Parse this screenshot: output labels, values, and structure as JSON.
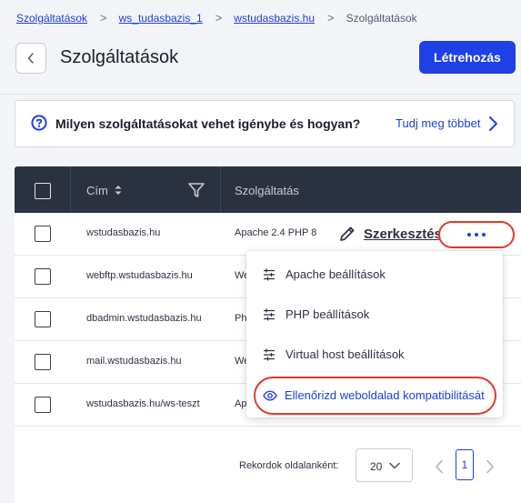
{
  "breadcrumb": {
    "items": [
      "Szolgáltatások",
      "ws_tudasbazis_1",
      "wstudasbazis.hu"
    ],
    "current": "Szolgáltatások",
    "separator": ">"
  },
  "header": {
    "title": "Szolgáltatások",
    "create_label": "Létrehozás"
  },
  "info": {
    "question": "Milyen szolgáltatásokat vehet igénybe és hogyan?",
    "link": "Tudj meg többet"
  },
  "table": {
    "columns": [
      "Cím",
      "Szolgáltatás"
    ],
    "rows": [
      {
        "name": "wstudasbazis.hu",
        "service": "Apache 2.4 PHP 8",
        "fade": ""
      },
      {
        "name": "webftp.wstudasbazis.hu",
        "service": "We",
        "fade": ""
      },
      {
        "name": "dbadmin.wstudasbazis.hu",
        "service": "Ph",
        "fade": ""
      },
      {
        "name": "mail.wstudasbazis.hu",
        "service": "We",
        "fade": ""
      },
      {
        "name": "wstudasbazis.hu/ws-teszt",
        "service": "Ap",
        "fade": ""
      }
    ],
    "edit_label": "Szerkesztés"
  },
  "menu": {
    "items": [
      {
        "label": "Apache beállítások",
        "icon": "sliders-icon"
      },
      {
        "label": "PHP beállítások",
        "icon": "sliders-icon"
      },
      {
        "label": "Virtual host beállítások",
        "icon": "sliders-icon"
      },
      {
        "label": "Ellenőrizd weboldalad kompatibilitását",
        "icon": "eye-icon"
      }
    ]
  },
  "pagination": {
    "records_label": "Rekordok oldalanként:",
    "page_size": "20",
    "current_page": "1"
  },
  "colors": {
    "accent": "#1f40e6",
    "header_bg": "#2a3140",
    "highlight_ring": "#e03a2a"
  }
}
